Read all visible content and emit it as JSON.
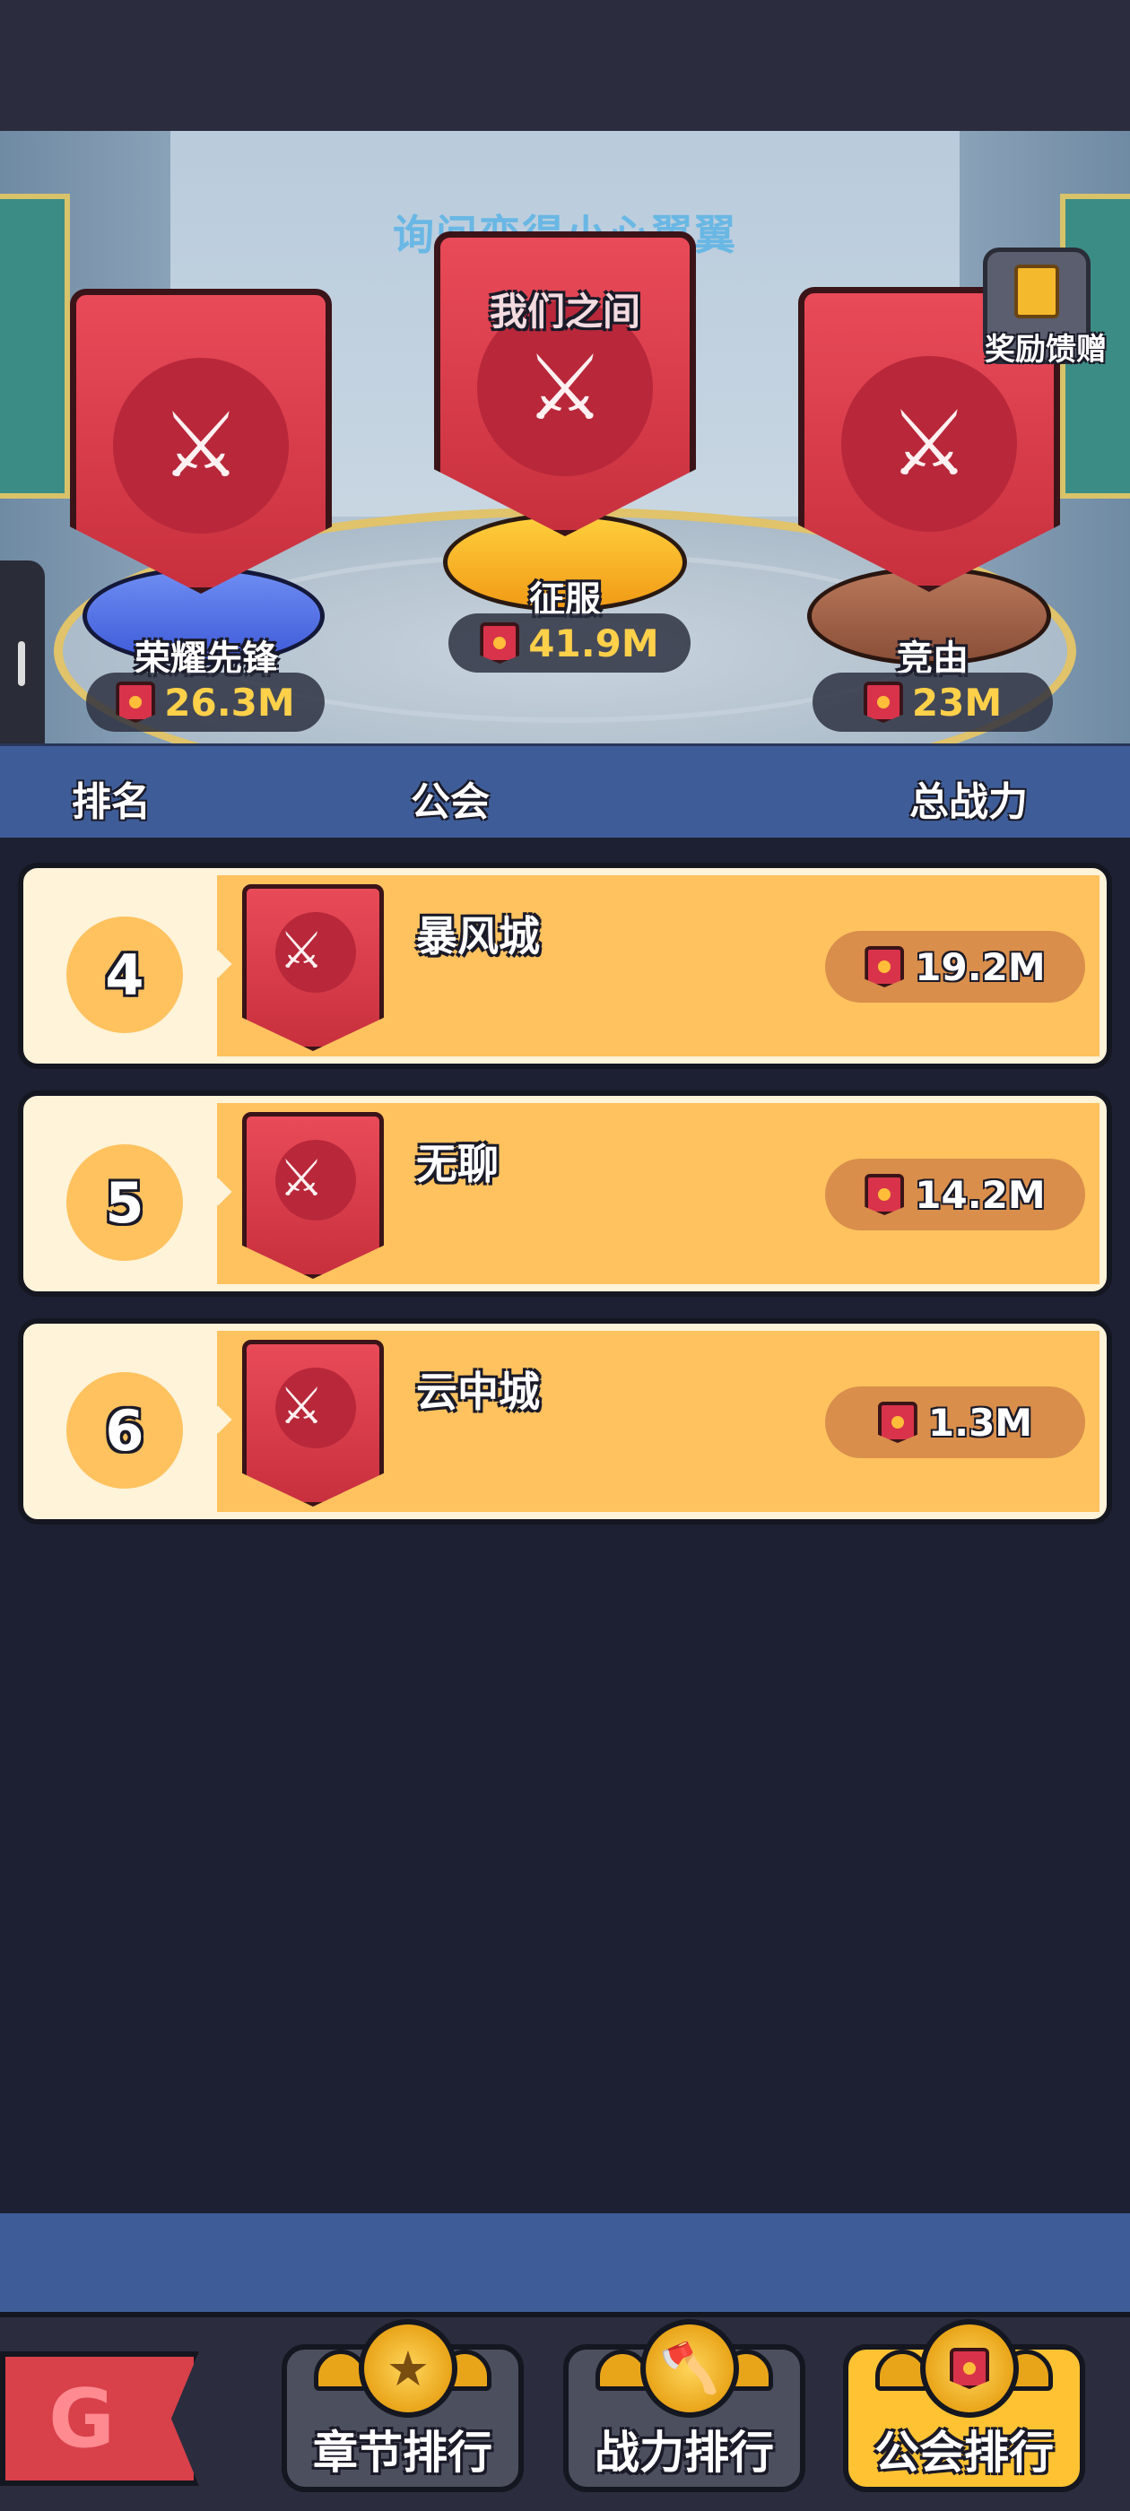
{
  "scene": {
    "caption": "询问变得小心翼翼",
    "reward_label": "奖励馈赠"
  },
  "podium": [
    {
      "place": 1,
      "name": "征服",
      "banner_text": "我们之间",
      "power": "41.9M"
    },
    {
      "place": 2,
      "name": "荣耀先锋",
      "power": "26.3M"
    },
    {
      "place": 3,
      "name": "竞由",
      "power": "23M"
    }
  ],
  "table": {
    "headers": {
      "rank": "排名",
      "guild": "公会",
      "power": "总战力"
    }
  },
  "rows": [
    {
      "rank": "4",
      "name": "暴风城",
      "power": "19.2M"
    },
    {
      "rank": "5",
      "name": "无聊",
      "power": "14.2M"
    },
    {
      "rank": "6",
      "name": "云中城",
      "power": "1.3M"
    }
  ],
  "nav": {
    "chapter": "章节排行",
    "power": "战力排行",
    "guild": "公会排行",
    "active": "guild"
  },
  "icons": {
    "emblem": "crossed-axes-icon",
    "power": "guild-flag-icon",
    "chapter": "star-icon",
    "axe": "axe-icon"
  }
}
